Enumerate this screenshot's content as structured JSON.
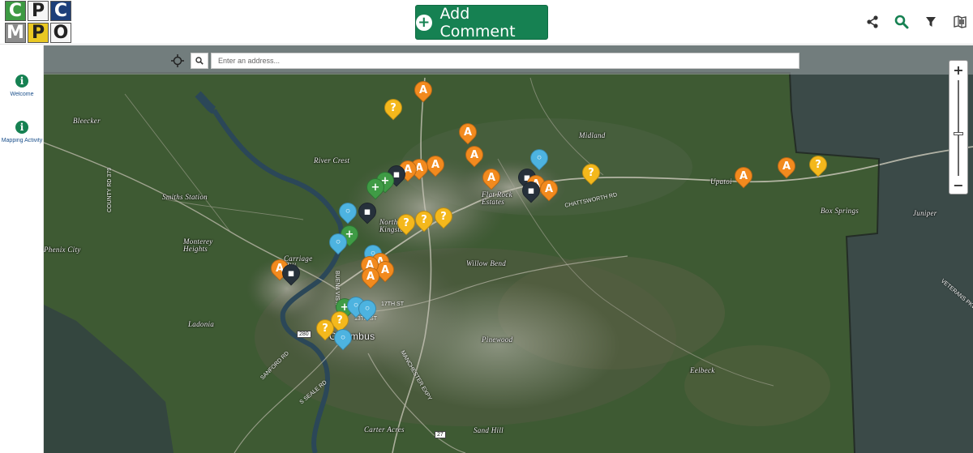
{
  "header": {
    "logo_letters": [
      "C",
      "P",
      "C",
      "M",
      "P",
      "O"
    ],
    "logo_colors": [
      "#3d9a43",
      "#f6f6f6",
      "#1d3f7a",
      "#8c8c8c",
      "#e9c823",
      "#f6f6f6"
    ],
    "add_comment_label": "Add Comment",
    "accent_color": "#168152",
    "tools": [
      "share-icon",
      "search-icon",
      "filter-icon",
      "map-legend-icon"
    ]
  },
  "sidebar": {
    "items": [
      {
        "label": "Welcome",
        "icon": "info-icon"
      },
      {
        "label": "Mapping Activity",
        "icon": "info-icon"
      }
    ]
  },
  "map": {
    "search_placeholder": "Enter an address...",
    "zoom_in_label": "+",
    "zoom_out_label": "−",
    "places": [
      "Bleecker",
      "River Crest",
      "Midland",
      "Flat Rock Estates",
      "Upatoi",
      "Box Springs",
      "Juniper",
      "Smiths Station",
      "Monterey Heights",
      "Phenix City",
      "Carriage Hill",
      "North Kingston",
      "Willow Bend",
      "Ladonia",
      "Columbus",
      "Pinewood",
      "Eelbeck",
      "Carter Acres",
      "Sand Hill"
    ],
    "roads": [
      "COUNTY RD 379",
      "CHATTSWORTH RD",
      "17TH ST",
      "13TH ST",
      "MANCHESTER EXPY",
      "SANFORD RD",
      "S SEALE RD",
      "BUENA VISTA",
      "VETERANS PKWY"
    ],
    "route_shields": [
      "280",
      "27"
    ],
    "marker_types": {
      "orange": "road-project-icon",
      "yellow": "question-icon",
      "blue": "bicycle-icon",
      "green": "thumbs-up-icon",
      "dark": "truck-icon"
    }
  }
}
